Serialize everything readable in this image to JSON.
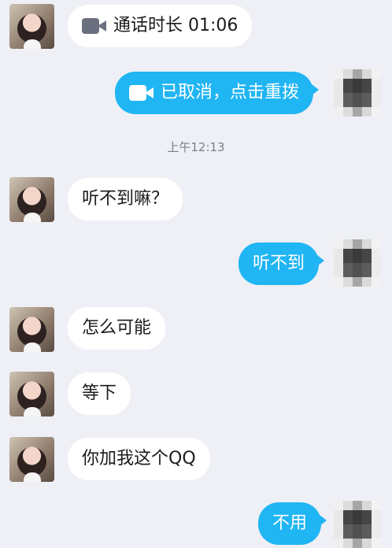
{
  "messages": {
    "m1": {
      "text": "通话时长 01:06",
      "icon": "video-camera-icon"
    },
    "m2": {
      "text": "已取消，点击重拨",
      "icon": "video-camera-icon"
    },
    "timestamp": "上午12:13",
    "m3": {
      "text": "听不到嘛？"
    },
    "m4": {
      "text": "听不到"
    },
    "m5": {
      "text": "怎么可能"
    },
    "m6": {
      "text": "等下"
    },
    "m7": {
      "text": "你加我这个QQ"
    },
    "m8": {
      "text": "不用"
    }
  },
  "colors": {
    "background": "#eef0f6",
    "outgoing_bubble": "#20b5f3",
    "incoming_bubble": "#ffffff",
    "timestamp": "#7b7f8a"
  }
}
